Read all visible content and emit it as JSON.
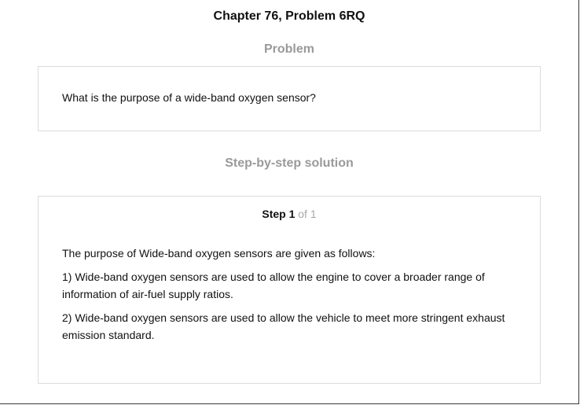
{
  "header": {
    "chapter_title": "Chapter 76, Problem 6RQ"
  },
  "problem": {
    "heading": "Problem",
    "text": "What is the purpose of a wide-band oxygen sensor?"
  },
  "solution": {
    "heading": "Step-by-step solution",
    "step_word": "Step 1",
    "step_total": " of 1",
    "paragraphs": [
      "The purpose of Wide-band oxygen sensors are given as follows:",
      "1) Wide-band oxygen sensors are used to allow the engine to cover a broader range of information of air-fuel supply ratios.",
      "2) Wide-band oxygen sensors are used to allow the vehicle to meet more stringent exhaust emission standard."
    ]
  }
}
